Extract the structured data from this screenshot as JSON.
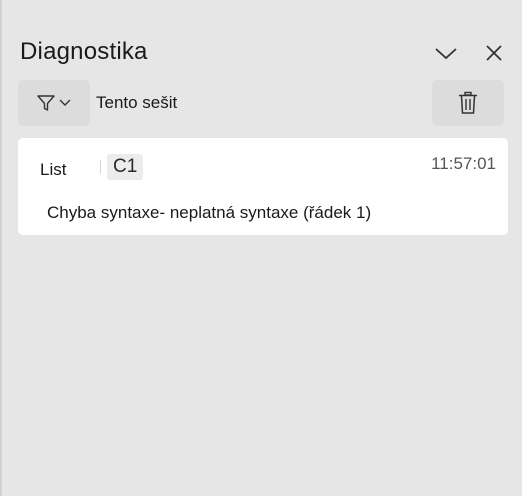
{
  "pane": {
    "title": "Diagnostika"
  },
  "toolbar": {
    "scope_label": "Tento sešit"
  },
  "diagnostics": [
    {
      "sheet": "List",
      "cell": "C1",
      "time": "11:57:01",
      "message": "Chyba syntaxe- neplatná syntaxe (řádek 1)"
    }
  ],
  "icons": {
    "collapse": "chevron-down-icon",
    "close": "close-icon",
    "filter": "filter-icon",
    "delete": "trash-icon"
  },
  "colors": {
    "background": "#e6e6e6",
    "button": "#dcdcdc",
    "card": "#ffffff",
    "text": "#1a1a1a",
    "muted_text": "#555555"
  }
}
